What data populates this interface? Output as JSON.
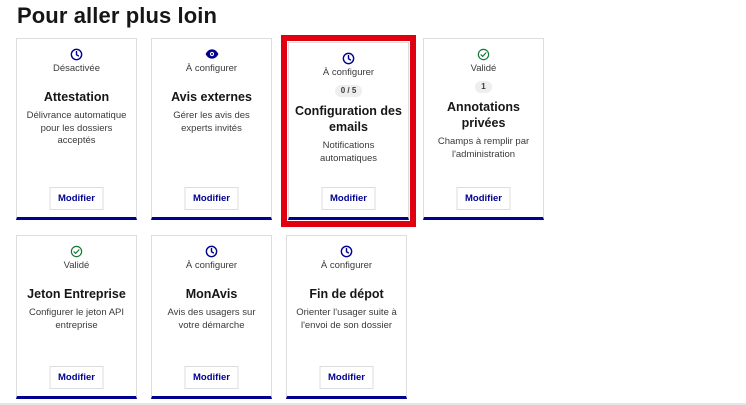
{
  "page": {
    "title": "Pour aller plus loin"
  },
  "cards": [
    {
      "status": "Désactivée",
      "badge": "",
      "title": "Attestation",
      "description": "Délivrance automatique pour les dossiers acceptés",
      "button": "Modifier"
    },
    {
      "status": "À configurer",
      "badge": "",
      "title": "Avis externes",
      "description": "Gérer les avis des experts invités",
      "button": "Modifier"
    },
    {
      "status": "À configurer",
      "badge": "0 / 5",
      "title": "Configuration des emails",
      "description": "Notifications automatiques",
      "button": "Modifier"
    },
    {
      "status": "Validé",
      "badge": "1",
      "title": "Annotations privées",
      "description": "Champs à remplir par l'administration",
      "button": "Modifier"
    },
    {
      "status": "Validé",
      "badge": "",
      "title": "Jeton Entreprise",
      "description": "Configurer le jeton API entreprise",
      "button": "Modifier"
    },
    {
      "status": "À configurer",
      "badge": "",
      "title": "MonAvis",
      "description": "Avis des usagers sur votre démarche",
      "button": "Modifier"
    },
    {
      "status": "À configurer",
      "badge": "",
      "title": "Fin de dépot",
      "description": "Orienter l'usager suite à l'envoi de son dossier",
      "button": "Modifier"
    }
  ],
  "icons": [
    "clock-icon",
    "eye-icon",
    "clock-icon",
    "check-circle-icon",
    "check-circle-icon",
    "clock-icon",
    "clock-icon"
  ],
  "colors": {
    "accent": "#000091",
    "highlight": "#e1000f",
    "success": "#18753c"
  }
}
